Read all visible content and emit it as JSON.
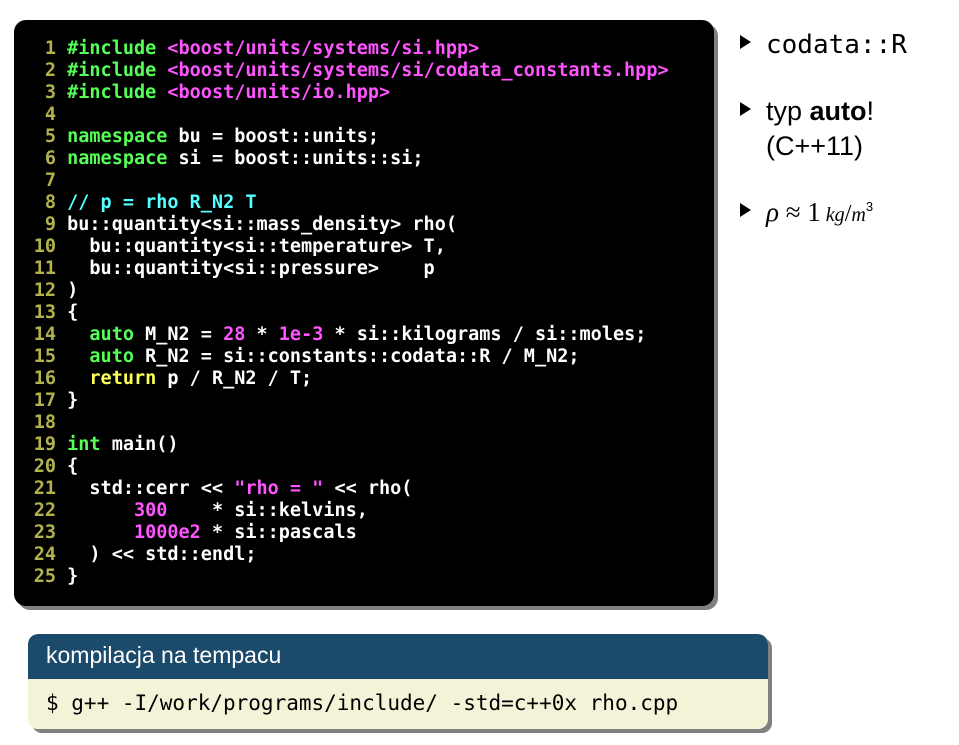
{
  "code": {
    "lines": [
      {
        "n": "1",
        "segs": [
          [
            " ",
            "w"
          ],
          [
            "#include",
            "g"
          ],
          [
            " ",
            "w"
          ],
          [
            "<boost/units/systems/si.hpp>",
            "m"
          ]
        ]
      },
      {
        "n": "2",
        "segs": [
          [
            " ",
            "w"
          ],
          [
            "#include",
            "g"
          ],
          [
            " ",
            "w"
          ],
          [
            "<boost/units/systems/si/codata_constants.hpp>",
            "m"
          ]
        ]
      },
      {
        "n": "3",
        "segs": [
          [
            " ",
            "w"
          ],
          [
            "#include",
            "g"
          ],
          [
            " ",
            "w"
          ],
          [
            "<boost/units/io.hpp>",
            "m"
          ]
        ]
      },
      {
        "n": "4",
        "segs": [
          [
            "",
            "w"
          ]
        ]
      },
      {
        "n": "5",
        "segs": [
          [
            " ",
            "w"
          ],
          [
            "namespace",
            "g"
          ],
          [
            " bu = boost::units;",
            "w"
          ]
        ]
      },
      {
        "n": "6",
        "segs": [
          [
            " ",
            "w"
          ],
          [
            "namespace",
            "g"
          ],
          [
            " si = boost::units::si;",
            "w"
          ]
        ]
      },
      {
        "n": "7",
        "segs": [
          [
            "",
            "w"
          ]
        ]
      },
      {
        "n": "8",
        "segs": [
          [
            " ",
            "w"
          ],
          [
            "// p = rho R_N2 T",
            "c"
          ]
        ]
      },
      {
        "n": "9",
        "segs": [
          [
            " bu::quantity<si::mass_density> rho(",
            "w"
          ]
        ]
      },
      {
        "n": "10",
        "segs": [
          [
            "   bu::quantity<si::temperature> T,",
            "w"
          ]
        ]
      },
      {
        "n": "11",
        "segs": [
          [
            "   bu::quantity<si::pressure>    p",
            "w"
          ]
        ]
      },
      {
        "n": "12",
        "segs": [
          [
            " )",
            "w"
          ]
        ]
      },
      {
        "n": "13",
        "segs": [
          [
            " {",
            "w"
          ]
        ]
      },
      {
        "n": "14",
        "segs": [
          [
            "   ",
            "w"
          ],
          [
            "auto",
            "g"
          ],
          [
            " M_N2 = ",
            "w"
          ],
          [
            "28",
            "m"
          ],
          [
            " * ",
            "w"
          ],
          [
            "1e-3",
            "m"
          ],
          [
            " * si::kilograms / si::moles;",
            "w"
          ]
        ]
      },
      {
        "n": "15",
        "segs": [
          [
            "   ",
            "w"
          ],
          [
            "auto",
            "g"
          ],
          [
            " R_N2 = si::constants::codata::R / M_N2;",
            "w"
          ]
        ]
      },
      {
        "n": "16",
        "segs": [
          [
            "   ",
            "w"
          ],
          [
            "return",
            "y"
          ],
          [
            " p / R_N2 / T;",
            "w"
          ]
        ]
      },
      {
        "n": "17",
        "segs": [
          [
            " }",
            "w"
          ]
        ]
      },
      {
        "n": "18",
        "segs": [
          [
            "",
            "w"
          ]
        ]
      },
      {
        "n": "19",
        "segs": [
          [
            " ",
            "w"
          ],
          [
            "int",
            "g"
          ],
          [
            " main()",
            "w"
          ]
        ]
      },
      {
        "n": "20",
        "segs": [
          [
            " {",
            "w"
          ]
        ]
      },
      {
        "n": "21",
        "segs": [
          [
            "   std::cerr << ",
            "w"
          ],
          [
            "\"rho = \"",
            "m"
          ],
          [
            " << rho(",
            "w"
          ]
        ]
      },
      {
        "n": "22",
        "segs": [
          [
            "       ",
            "w"
          ],
          [
            "300",
            "m"
          ],
          [
            "    * si::kelvins,",
            "w"
          ]
        ]
      },
      {
        "n": "23",
        "segs": [
          [
            "       ",
            "w"
          ],
          [
            "1000e2",
            "m"
          ],
          [
            " * si::pascals",
            "w"
          ]
        ]
      },
      {
        "n": "24",
        "segs": [
          [
            "   ) << std::endl;",
            "w"
          ]
        ]
      },
      {
        "n": "25",
        "segs": [
          [
            " }",
            "w"
          ]
        ]
      }
    ]
  },
  "side": {
    "item1": "codata::R",
    "item2_pre": "typ ",
    "item2_bold": "auto",
    "item2_excl": "!",
    "item2_sub": "(C++11)",
    "item3_rho": "ρ",
    "item3_approx": " ≈ ",
    "item3_one": "1",
    "item3_kg": " kg",
    "item3_slash": "/",
    "item3_m": "m",
    "item3_sup": "3"
  },
  "lower": {
    "title": "kompilacja na tempacu",
    "cmd": "$ g++ -I/work/programs/include/ -std=c++0x rho.cpp"
  }
}
